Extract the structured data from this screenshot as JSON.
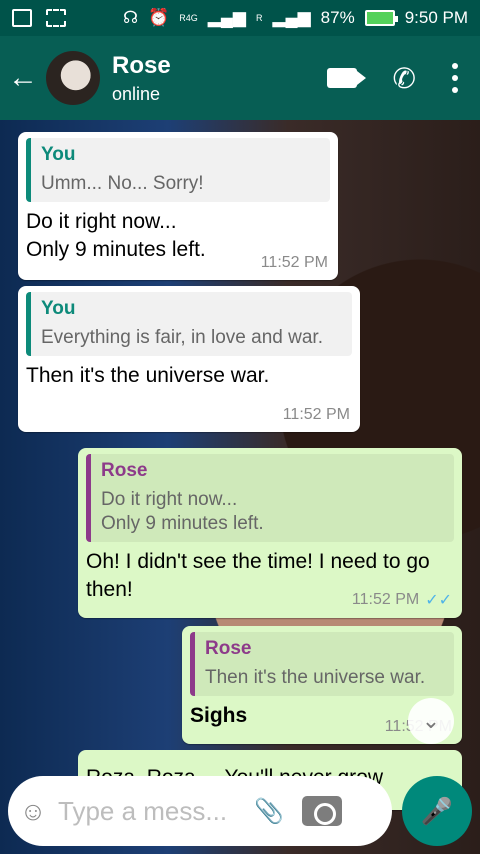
{
  "status_bar": {
    "network_4g": "R4G",
    "network_r": "R",
    "battery": "87%",
    "time": "9:50 PM"
  },
  "header": {
    "contact_name": "Rose",
    "contact_status": "online",
    "icons": [
      "back-arrow-icon",
      "video-call-icon",
      "phone-icon",
      "more-icon"
    ]
  },
  "messages": [
    {
      "direction": "incoming",
      "quote_author": "You",
      "quote_text": "Umm... No... Sorry!",
      "text": "Do it right now...\nOnly 9 minutes left.",
      "time": "11:52 PM"
    },
    {
      "direction": "incoming",
      "quote_author": "You",
      "quote_text": "Everything is fair, in love and war.",
      "text": "Then it's the universe war.",
      "time": "11:52 PM"
    },
    {
      "direction": "outgoing",
      "quote_author": "Rose",
      "quote_text": "Do it right now...\nOnly 9 minutes left.",
      "text": "Oh! I didn't see the time! I need to go then!",
      "time": "11:52 PM",
      "read": true
    },
    {
      "direction": "outgoing",
      "quote_author": "Rose",
      "quote_text": "Then it's the universe war.",
      "text": "Sighs",
      "time": "11:52 PM"
    },
    {
      "direction": "outgoing",
      "text": "Roza, Roza.... You'll never grow"
    }
  ],
  "input": {
    "placeholder": "Type a mess..."
  },
  "colors": {
    "header": "#075e54",
    "outgoing_bubble": "#dcf8c6",
    "incoming_bubble": "#ffffff",
    "accent": "#00897b"
  }
}
